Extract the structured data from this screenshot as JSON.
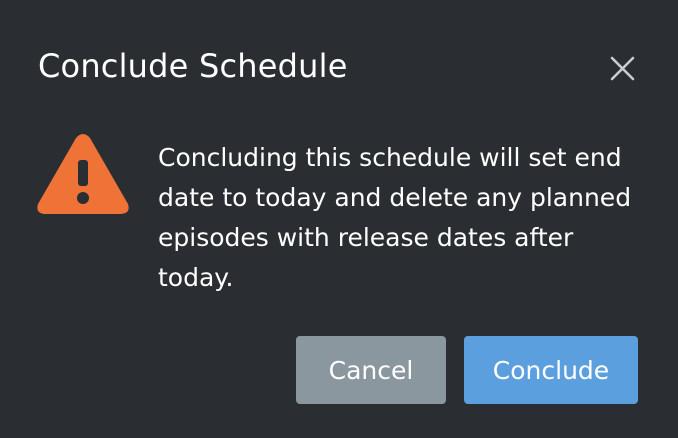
{
  "dialog": {
    "title": "Conclude Schedule",
    "message": "Concluding this schedule will set end date to today and delete any planned episodes with release dates after today.",
    "close_icon": "close-icon",
    "warning_icon": "warning-triangle-icon",
    "cancel_label": "Cancel",
    "confirm_label": "Conclude"
  },
  "colors": {
    "background": "#2a2d31",
    "warning": "#ef7237",
    "cancel_button": "#8b979f",
    "confirm_button": "#5b9fde"
  }
}
